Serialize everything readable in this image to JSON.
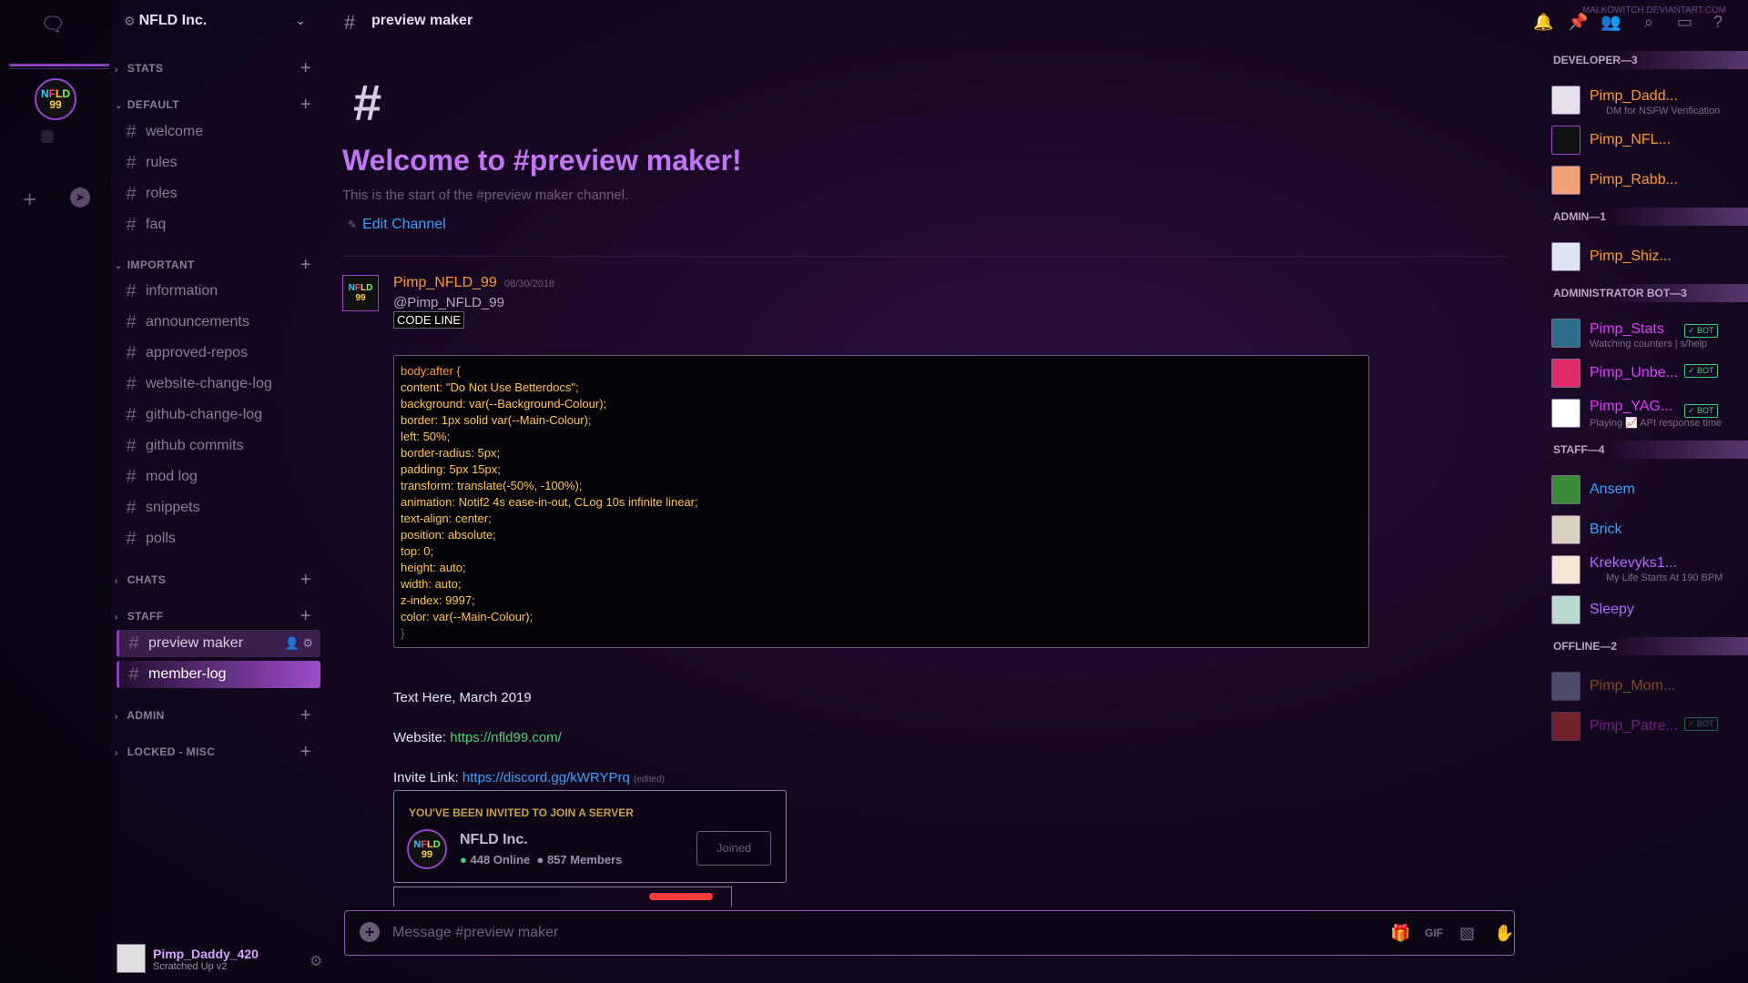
{
  "colors": {
    "accent": "#8a3fc0",
    "developer": "#ff9a2e",
    "bot": "#e33bff",
    "staff": "#35a3ff",
    "welcome": "#c274f5",
    "link": "#48d270"
  },
  "server": {
    "name": "NFLD Inc.",
    "icon_text": [
      "NFLD",
      "99"
    ]
  },
  "categories": {
    "stats": "STATS",
    "default": "DEFAULT",
    "important": "IMPORTANT",
    "chats": "CHATS",
    "staff": "STAFF",
    "admin": "ADMIN",
    "locked": "LOCKED - MISC"
  },
  "channels": {
    "default": [
      "welcome",
      "rules",
      "roles",
      "faq"
    ],
    "important": [
      "information",
      "announcements",
      "approved-repos",
      "website-change-log",
      "github-change-log",
      "github commits",
      "mod log",
      "snippets",
      "polls"
    ],
    "staff": [
      "preview maker",
      "member-log"
    ]
  },
  "user": {
    "name": "Pimp_Daddy_420",
    "status": "Scratched Up v2"
  },
  "header": {
    "channel": "preview maker"
  },
  "intro": {
    "title": "Welcome to #preview maker!",
    "subtitle": "This is the start of the #preview maker channel.",
    "edit": "Edit Channel"
  },
  "message": {
    "author": "Pimp_NFLD_99",
    "timestamp": "08/30/2018",
    "mention": "@Pimp_NFLD_99",
    "code_inline": "CODE LINE",
    "code_lines": [
      "body:after {",
      "content: \"Do Not Use Betterdocs\";",
      "background: var(--Background-Colour);",
      "border: 1px solid var(--Main-Colour);",
      "left: 50%;",
      "border-radius: 5px;",
      "padding: 5px 15px;",
      "transform: translate(-50%, -100%);",
      "animation: Notif2 4s ease-in-out, CLog 10s infinite linear;",
      "text-align: center;",
      "position: absolute;",
      "top: 0;",
      "height: auto;",
      "width: auto;",
      "z-index: 9997;",
      "color: var(--Main-Colour);",
      "}"
    ],
    "text_here": "Text Here, March 2019",
    "website_label": "Website:",
    "website_url": "https://nfld99.com/",
    "invite_label": "Invite Link:",
    "invite_url": "https://discord.gg/kWRYPrq",
    "edited": "(edited)"
  },
  "invite": {
    "header": "YOU'VE BEEN INVITED TO JOIN A SERVER",
    "server": "NFLD Inc.",
    "online": "448 Online",
    "members": "857 Members",
    "button": "Joined"
  },
  "composer": {
    "placeholder": "Message #preview maker"
  },
  "watermark": "MALKOWITCH.DEVIANTART.COM",
  "members": {
    "roles": {
      "developer": "DEVELOPER—3",
      "admin": "ADMIN—1",
      "admin_bot": "ADMINISTRATOR BOT—3",
      "staff": "STAFF—4",
      "offline": "OFFLINE—2"
    },
    "bot_tag": "✓ BOT",
    "developer": [
      {
        "name": "Pimp_Dadd...",
        "status": "DM for NSFW Verification"
      },
      {
        "name": "Pimp_NFL...",
        "status": ""
      },
      {
        "name": "Pimp_Rabb...",
        "status": ""
      }
    ],
    "admin": [
      {
        "name": "Pimp_Shiz...",
        "status": ""
      }
    ],
    "admin_bot": [
      {
        "name": "Pimp_Stats",
        "status": "Watching counters | s/help"
      },
      {
        "name": "Pimp_Unbe...",
        "status": ""
      },
      {
        "name": "Pimp_YAG...",
        "status": "Playing 📈 API response time"
      }
    ],
    "staff": [
      {
        "name": "Ansem",
        "status": ""
      },
      {
        "name": "Brick",
        "status": ""
      },
      {
        "name": "Krekevyks1...",
        "status": "My Life Starts At 190 BPM"
      },
      {
        "name": "Sleepy",
        "status": ""
      }
    ],
    "offline": [
      {
        "name": "Pimp_Mom...",
        "status": ""
      },
      {
        "name": "Pimp_Patre...",
        "status": ""
      }
    ]
  }
}
